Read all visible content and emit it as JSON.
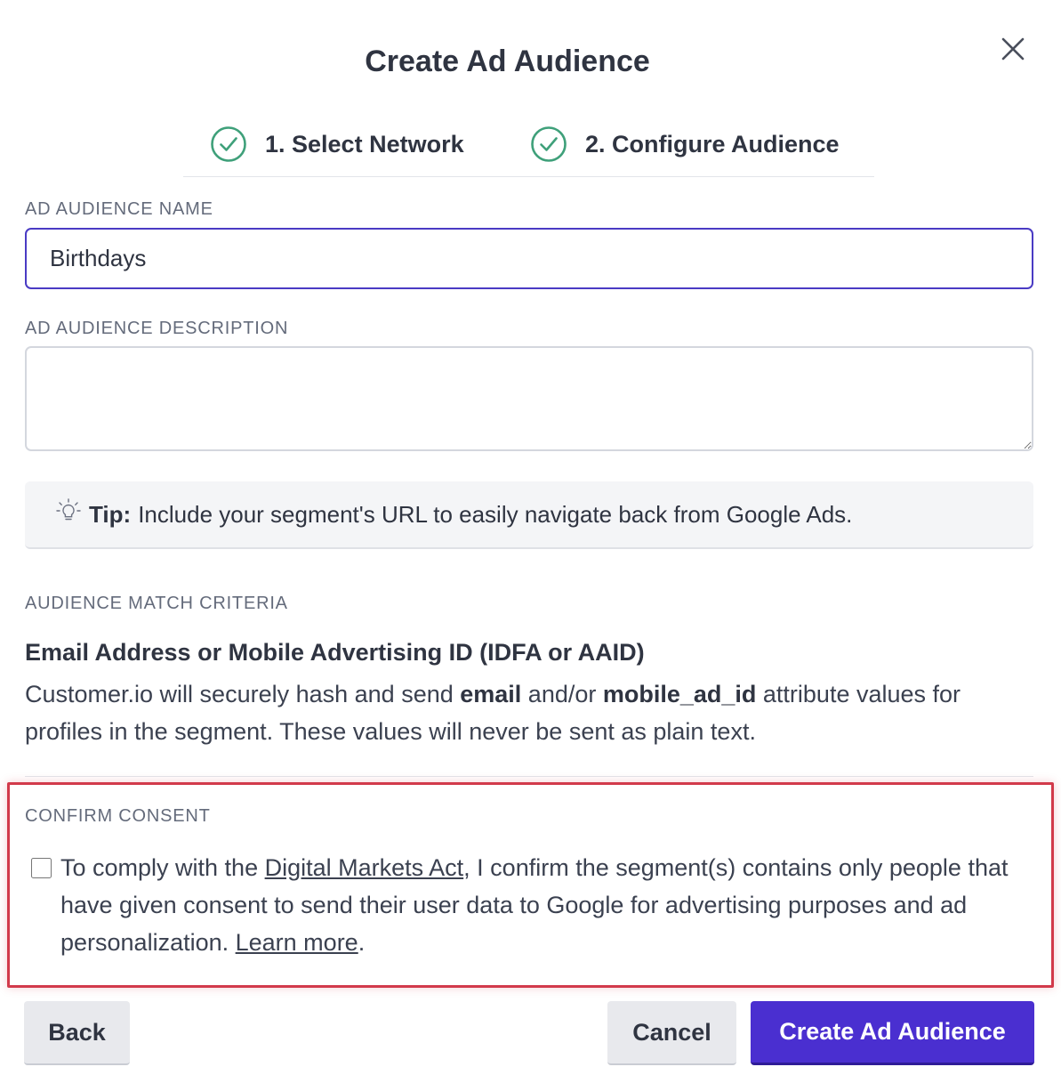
{
  "modal": {
    "title": "Create Ad Audience",
    "close_icon": "close-icon"
  },
  "stepper": {
    "steps": [
      {
        "label": "1. Select Network",
        "icon": "check-circle-icon",
        "status": "complete"
      },
      {
        "label": "2. Configure Audience",
        "icon": "check-circle-icon",
        "status": "complete"
      }
    ],
    "check_color": "#3fa07a"
  },
  "form": {
    "name_label": "AD AUDIENCE NAME",
    "name_value": "Birthdays",
    "description_label": "AD AUDIENCE DESCRIPTION",
    "description_value": ""
  },
  "tip": {
    "icon": "lightbulb-icon",
    "strong": "Tip:",
    "text": "Include your segment's URL to easily navigate back from Google Ads."
  },
  "match_criteria": {
    "label": "AUDIENCE MATCH CRITERIA",
    "title": "Email Address or Mobile Advertising ID (IDFA or AAID)",
    "desc_part1": "Customer.io will securely hash and send ",
    "desc_email": "email",
    "desc_part2": " and/or ",
    "desc_mobile": "mobile_ad_id",
    "desc_part3": " attribute values for profiles in the segment. These values will never be sent as plain text."
  },
  "consent": {
    "label": "CONFIRM CONSENT",
    "checked": false,
    "text_part1": "To comply with the ",
    "link_dma": "Digital Markets Act",
    "text_part2": ", I confirm the segment(s) contains only people that have given consent to send their user data to Google for advertising purposes and ad personalization. ",
    "link_learn": "Learn more",
    "text_part3": ".",
    "highlight_color": "#d23a4b"
  },
  "buttons": {
    "back": "Back",
    "cancel": "Cancel",
    "create": "Create Ad Audience",
    "primary_color": "#4a2fd0"
  }
}
